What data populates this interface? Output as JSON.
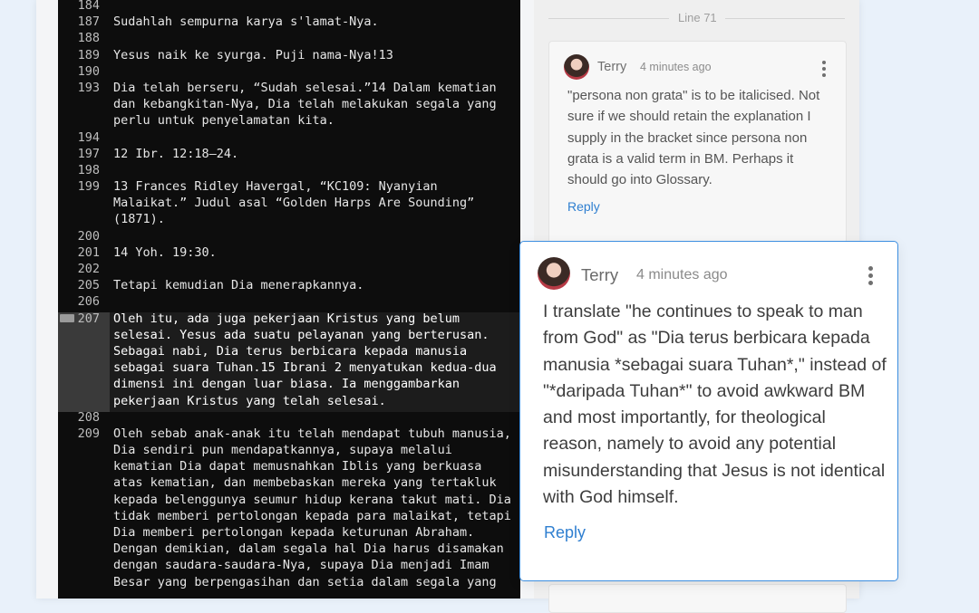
{
  "editor": {
    "lines": [
      {
        "num": "184",
        "text": ""
      },
      {
        "num": "187",
        "text": "Sudahlah sempurna karya s'lamat-Nya."
      },
      {
        "num": "188",
        "text": ""
      },
      {
        "num": "189",
        "text": "Yesus naik ke syurga. Puji nama-Nya!13"
      },
      {
        "num": "190",
        "text": ""
      },
      {
        "num": "193",
        "text": "Dia telah berseru, “Sudah selesai.”14 Dalam kematian"
      },
      {
        "num": "",
        "text": "dan kebangkitan-Nya, Dia telah melakukan segala yang"
      },
      {
        "num": "",
        "text": "perlu untuk penyelamatan kita."
      },
      {
        "num": "194",
        "text": ""
      },
      {
        "num": "197",
        "text": "12 Ibr. 12:18–24."
      },
      {
        "num": "198",
        "text": ""
      },
      {
        "num": "199",
        "text": "13 Frances Ridley Havergal, “KC109: Nyanyian"
      },
      {
        "num": "",
        "text": "Malaikat.” Judul asal “Golden Harps Are Sounding”"
      },
      {
        "num": "",
        "text": "(1871)."
      },
      {
        "num": "200",
        "text": ""
      },
      {
        "num": "201",
        "text": "14 Yoh. 19:30."
      },
      {
        "num": "202",
        "text": ""
      },
      {
        "num": "205",
        "text": "Tetapi kemudian Dia menerapkannya."
      },
      {
        "num": "206",
        "text": ""
      },
      {
        "num": "207",
        "text": "Oleh itu, ada juga pekerjaan Kristus yang belum",
        "hl": true
      },
      {
        "num": "",
        "text": "selesai. Yesus ada suatu pelayanan yang berterusan.",
        "hl": true
      },
      {
        "num": "",
        "text": "Sebagai nabi, Dia terus berbicara kepada manusia",
        "hl": true
      },
      {
        "num": "",
        "text": "sebagai suara Tuhan.15 Ibrani 2 menyatukan kedua-dua",
        "hl": true
      },
      {
        "num": "",
        "text": "dimensi ini dengan luar biasa. Ia menggambarkan",
        "hl": true
      },
      {
        "num": "",
        "text": "pekerjaan Kristus yang telah selesai.",
        "hl": true
      },
      {
        "num": "208",
        "text": ""
      },
      {
        "num": "209",
        "text": "Oleh sebab anak-anak itu telah mendapat tubuh manusia,"
      },
      {
        "num": "",
        "text": "Dia sendiri pun mendapatkannya, supaya melalui"
      },
      {
        "num": "",
        "text": "kematian Dia dapat memusnahkan Iblis yang berkuasa"
      },
      {
        "num": "",
        "text": "atas kematian, dan membebaskan mereka yang tertakluk"
      },
      {
        "num": "",
        "text": "kepada belenggunya seumur hidup kerana takut mati. Dia"
      },
      {
        "num": "",
        "text": "tidak memberi pertolongan kepada para malaikat, tetapi"
      },
      {
        "num": "",
        "text": "Dia memberi pertolongan kepada keturunan Abraham."
      },
      {
        "num": "",
        "text": "Dengan demikian, dalam segala hal Dia harus disamakan"
      },
      {
        "num": "",
        "text": "dengan saudara-saudara-Nya, supaya Dia menjadi Imam"
      },
      {
        "num": "",
        "text": "Besar yang berpengasihan dan setia dalam segala yang"
      }
    ]
  },
  "sidebar": {
    "separator_label": "Line 71",
    "comment_small": {
      "author": "Terry",
      "time": "4 minutes ago",
      "text": "\"persona non grata\" is to be italicised. Not sure if we should retain the explanation I supply in the bracket since persona non grata is a valid term in BM. Perhaps it should go into Glossary.",
      "reply_label": "Reply"
    }
  },
  "active_comment": {
    "author": "Terry",
    "time": "4 minutes ago",
    "text": "I translate \"he continues to speak to man from God\" as \"Dia terus berbicara kepada manusia *sebagai suara Tuhan*,\" instead of \"*daripada Tuhan*\" to avoid awkward BM and most importantly, for theological reason, namely to avoid any potential misunderstanding that Jesus is not identical with God himself.",
    "reply_label": "Reply"
  }
}
